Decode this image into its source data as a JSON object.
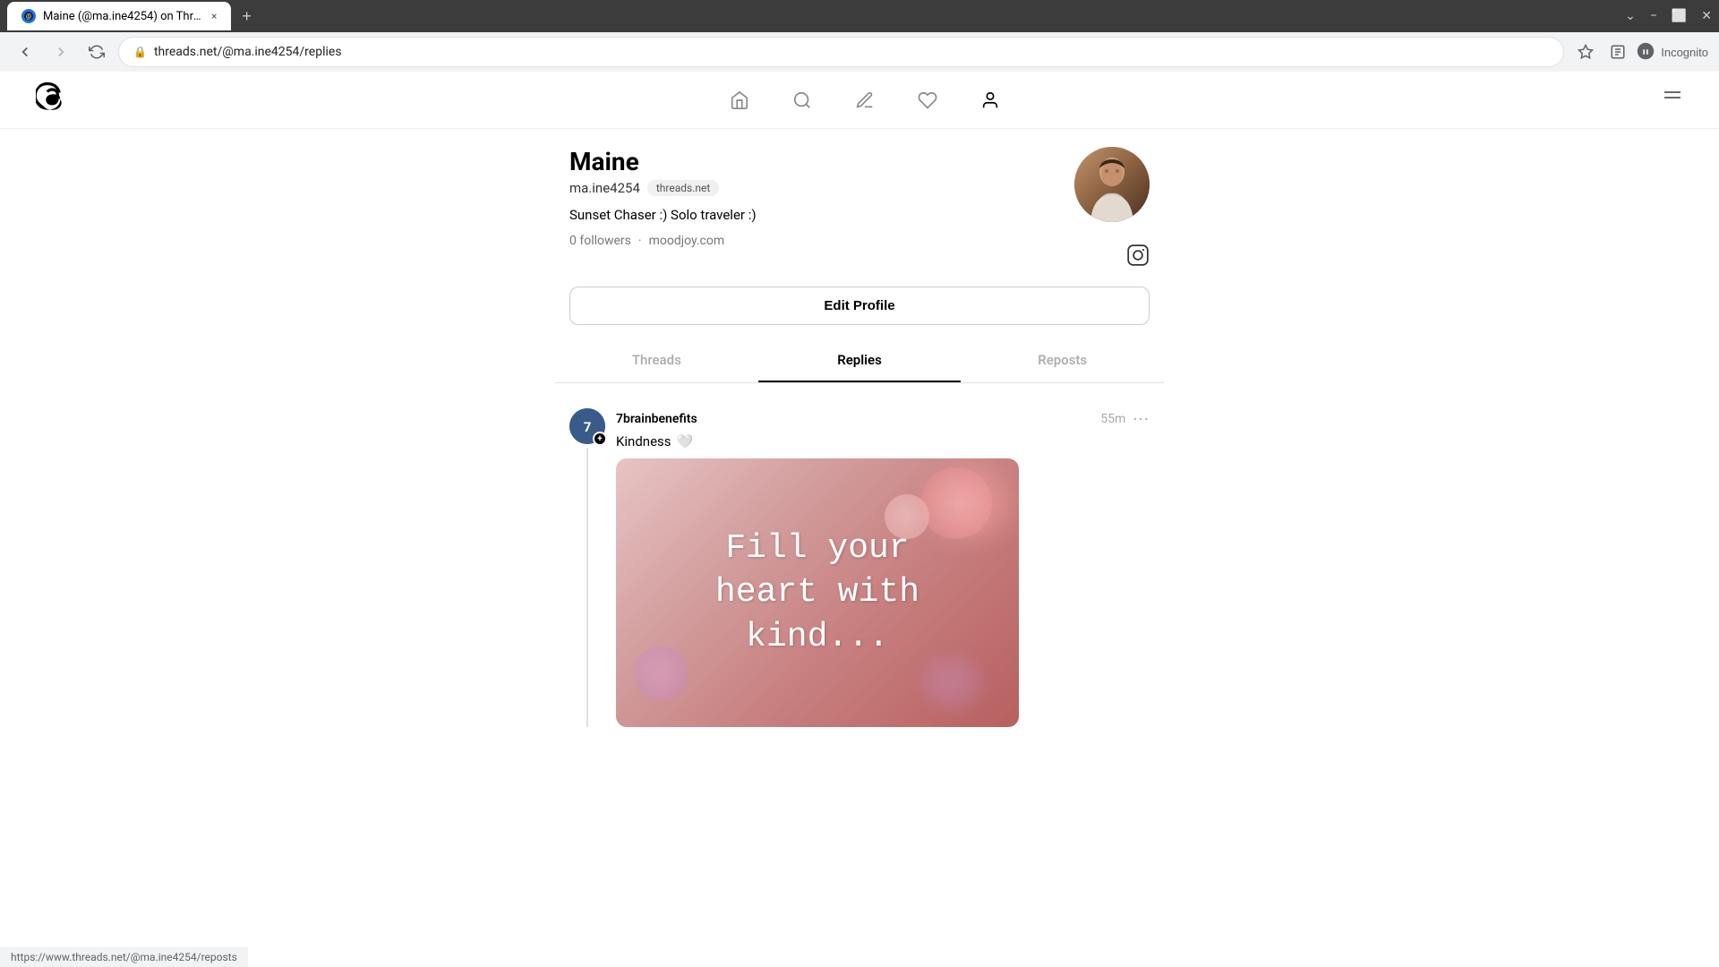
{
  "browser": {
    "tab_title": "Maine (@ma.ine4254) on Threa...",
    "tab_close": "×",
    "tab_new": "+",
    "address": "threads.net/@ma.ine4254/replies",
    "address_icon": "🔒",
    "window_minimize": "−",
    "window_maximize": "⬜",
    "window_close": "✕",
    "incognito_label": "Incognito",
    "window_controls_down": "⌄"
  },
  "nav": {
    "logo_alt": "Threads",
    "home_icon": "home",
    "search_icon": "search",
    "compose_icon": "compose",
    "activity_icon": "heart",
    "profile_icon": "person",
    "menu_icon": "menu"
  },
  "profile": {
    "name": "Maine",
    "username": "ma.ine4254",
    "platform_badge": "threads.net",
    "bio": "Sunset Chaser :) Solo traveler :)",
    "followers": "0 followers",
    "dot_separator": "·",
    "website": "moodjoy.com",
    "instagram_icon": "instagram",
    "edit_profile_label": "Edit Profile",
    "tab_threads": "Threads",
    "tab_replies": "Replies",
    "tab_reposts": "Reposts"
  },
  "post": {
    "username": "7brainbenefits",
    "time": "55m",
    "text": "Kindness",
    "heart_icon": "🤍",
    "more_icon": "···",
    "image_text_line1": "Fill your",
    "image_text_line2": "heart with",
    "image_text_line3": "kind..."
  },
  "status_bar": {
    "url": "https://www.threads.net/@ma.ine4254/reposts"
  }
}
